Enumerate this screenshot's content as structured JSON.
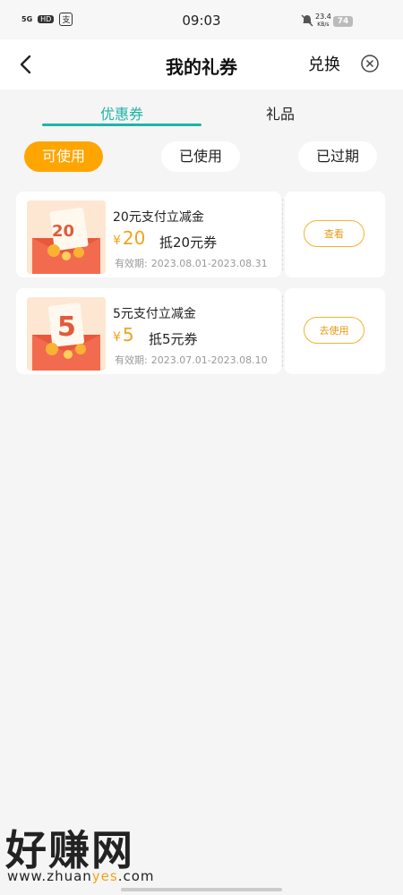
{
  "status_bar": {
    "network": "5G",
    "hd": "HD",
    "pay_icon_text": "支",
    "time": "09:03",
    "speed": "23.4",
    "speed_unit": "KB/s",
    "battery": "74"
  },
  "header": {
    "title": "我的礼券",
    "redeem_label": "兑换"
  },
  "tabs": [
    {
      "label": "优惠券",
      "active": true
    },
    {
      "label": "礼品",
      "active": false
    }
  ],
  "filters": [
    {
      "label": "可使用",
      "active": true
    },
    {
      "label": "已使用",
      "active": false
    },
    {
      "label": "已过期",
      "active": false
    }
  ],
  "coupons": [
    {
      "thumb_number": "20",
      "title": "20元支付立减金",
      "currency": "¥",
      "amount": "20",
      "desc": "抵20元券",
      "valid_label": "有效期:",
      "valid_range": "2023.08.01-2023.08.31",
      "action": "查看"
    },
    {
      "thumb_number": "5",
      "title": "5元支付立减金",
      "currency": "¥",
      "amount": "5",
      "desc": "抵5元券",
      "valid_label": "有效期:",
      "valid_range": "2023.07.01-2023.08.10",
      "action": "去使用"
    }
  ],
  "watermark": {
    "text": "好赚网",
    "url_a": "www.zhuan",
    "url_b": "yes",
    "url_c": ".com"
  },
  "colors": {
    "accent_teal": "#1fb4a6",
    "accent_orange": "#ffa500",
    "amount_orange": "#f3a21b"
  }
}
